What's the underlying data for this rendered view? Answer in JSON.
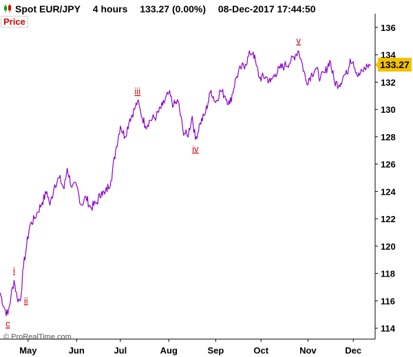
{
  "header": {
    "instrument": "Spot EUR/JPY",
    "timeframe": "4 hours",
    "quote": "133.27 (0.00%)",
    "datetime": "08-Dec-2017 17:44:50"
  },
  "panel_label": "Price",
  "current_price_label": "133.27",
  "credit": "© ProRealTime.com",
  "colors": {
    "line": "#8800cc",
    "wave_label": "#d00000",
    "price_badge": "#f2c200",
    "icon_up": "#00aa00",
    "icon_down": "#dd0000"
  },
  "icons": {
    "chart_type": "candlestick-icon"
  },
  "chart_data": {
    "type": "line",
    "x_unit": "4-hour bars",
    "x_ticks": [
      {
        "label": "May",
        "x": 18
      },
      {
        "label": "Jun",
        "x": 49
      },
      {
        "label": "Jul",
        "x": 77
      },
      {
        "label": "Aug",
        "x": 108
      },
      {
        "label": "Sep",
        "x": 138
      },
      {
        "label": "Oct",
        "x": 167
      },
      {
        "label": "Nov",
        "x": 197
      },
      {
        "label": "Dec",
        "x": 226
      }
    ],
    "y_ticks": [
      114,
      116,
      118,
      120,
      122,
      124,
      126,
      128,
      130,
      132,
      134,
      136
    ],
    "xlim": [
      0,
      240
    ],
    "ylim": [
      113.2,
      136.8
    ],
    "series": [
      {
        "values": [
          [
            0,
            116.6
          ],
          [
            3,
            115.4
          ],
          [
            5,
            115.0
          ],
          [
            7,
            116.3
          ],
          [
            9,
            117.5
          ],
          [
            11,
            116.2
          ],
          [
            13,
            116.0
          ],
          [
            15,
            118.5
          ],
          [
            17,
            120.0
          ],
          [
            19,
            121.5
          ],
          [
            22,
            122.0
          ],
          [
            24,
            122.5
          ],
          [
            27,
            123.2
          ],
          [
            30,
            124.0
          ],
          [
            32,
            123.0
          ],
          [
            35,
            124.5
          ],
          [
            38,
            125.0
          ],
          [
            41,
            124.2
          ],
          [
            43,
            125.7
          ],
          [
            46,
            124.3
          ],
          [
            49,
            124.4
          ],
          [
            52,
            123.0
          ],
          [
            55,
            123.6
          ],
          [
            58,
            122.8
          ],
          [
            62,
            123.2
          ],
          [
            65,
            124.0
          ],
          [
            67,
            123.8
          ],
          [
            71,
            124.8
          ],
          [
            74,
            127.0
          ],
          [
            77,
            128.8
          ],
          [
            80,
            128.0
          ],
          [
            83,
            129.3
          ],
          [
            86,
            130.0
          ],
          [
            88,
            130.6
          ],
          [
            90,
            129.8
          ],
          [
            93,
            128.8
          ],
          [
            96,
            129.2
          ],
          [
            100,
            129.5
          ],
          [
            104,
            130.3
          ],
          [
            108,
            131.2
          ],
          [
            111,
            130.3
          ],
          [
            114,
            130.6
          ],
          [
            117,
            128.5
          ],
          [
            120,
            128.0
          ],
          [
            123,
            129.5
          ],
          [
            125,
            127.8
          ],
          [
            128,
            129.0
          ],
          [
            131,
            129.6
          ],
          [
            135,
            131.4
          ],
          [
            138,
            130.5
          ],
          [
            141,
            131.4
          ],
          [
            144,
            131.0
          ],
          [
            147,
            130.4
          ],
          [
            151,
            132.3
          ],
          [
            154,
            133.0
          ],
          [
            157,
            133.3
          ],
          [
            160,
            134.1
          ],
          [
            162,
            134.2
          ],
          [
            164,
            133.2
          ],
          [
            166,
            132.3
          ],
          [
            170,
            132.4
          ],
          [
            173,
            132.0
          ],
          [
            176,
            132.6
          ],
          [
            179,
            133.0
          ],
          [
            182,
            133.2
          ],
          [
            186,
            133.5
          ],
          [
            189,
            134.0
          ],
          [
            191,
            134.3
          ],
          [
            193,
            133.5
          ],
          [
            196,
            132.0
          ],
          [
            199,
            132.5
          ],
          [
            202,
            133.0
          ],
          [
            205,
            132.3
          ],
          [
            208,
            132.7
          ],
          [
            211,
            133.6
          ],
          [
            214,
            132.0
          ],
          [
            217,
            131.8
          ],
          [
            220,
            132.5
          ],
          [
            222,
            132.6
          ],
          [
            224,
            133.7
          ],
          [
            226,
            133.5
          ],
          [
            229,
            132.4
          ],
          [
            232,
            132.8
          ],
          [
            235,
            133.2
          ],
          [
            237,
            133.27
          ]
        ]
      }
    ],
    "annotations": [
      {
        "text": "c",
        "x": 5,
        "y": 115.0,
        "pos": "below"
      },
      {
        "text": "i",
        "x": 9,
        "y": 117.5,
        "pos": "above"
      },
      {
        "text": "ii",
        "x": 14,
        "y": 116.0,
        "pos": "right"
      },
      {
        "text": "iii",
        "x": 88,
        "y": 130.6,
        "pos": "above"
      },
      {
        "text": "iv",
        "x": 125,
        "y": 127.8,
        "pos": "below"
      },
      {
        "text": "v",
        "x": 191,
        "y": 134.3,
        "pos": "above"
      }
    ],
    "current_value": 133.27,
    "grid": false
  }
}
